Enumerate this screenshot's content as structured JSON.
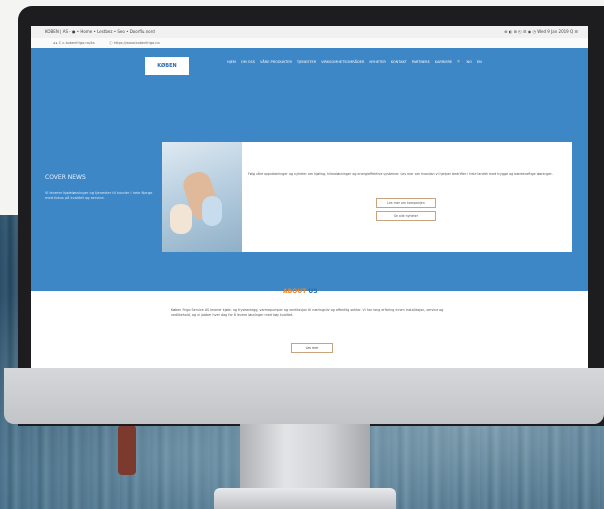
{
  "browser": {
    "tab_title": "KOBEN | AS - ● • Home • Lestbez • Seo • Doorflu.nord",
    "system_info": "⊕ ◐ ⊞ ◴ ☰ ◉ ◷  Wed 9 Jan 2019  Q ☰",
    "url": "◂  ▸  C  ⌂  kobenfrigo.no/ks",
    "url_secure": "ⓘ  https://www.kobenfrigo.no"
  },
  "site": {
    "logo_text": "KØBEN",
    "nav": [
      "HJEM",
      "OM OSS",
      "VÅRE PRODUKTER",
      "TJENESTER",
      "VIRKSOMHETSOMRÅDER",
      "NYHETER",
      "KONTAKT",
      "PARTNERE",
      "KARRIERE",
      "🔍",
      "NO",
      "EN"
    ],
    "hero_title": "COVER NEWS",
    "hero_desc": "Vi leverer kjøleløsninger og tjenester til kunder i hele Norge med fokus på kvalitet og service.",
    "card_text": "Følg våre oppdateringer og nyheter om kjøling, klimaløsninger og energieffektive systemer. Les mer om hvordan vi hjelper bedrifter i hele landet med trygge og bærekraftige løsninger.",
    "card_button_1": "Les mer om kampanjen",
    "card_button_2": "Se alle nyheter",
    "section_title_1": "ABOUT",
    "section_title_2": "US",
    "section_text": "Køben Frigo Service AS leverer kjøle- og fryseanlegg, varmepumper og ventilasjon til næringsliv og offentlig sektor. Vi har lang erfaring innen installasjon, service og vedlikehold, og vi jobber hver dag for å levere løsninger med høy kvalitet.",
    "section_button": "Les mer"
  },
  "colors": {
    "hero_blue": "#3d87c7",
    "accent_orange": "#e8862a"
  }
}
